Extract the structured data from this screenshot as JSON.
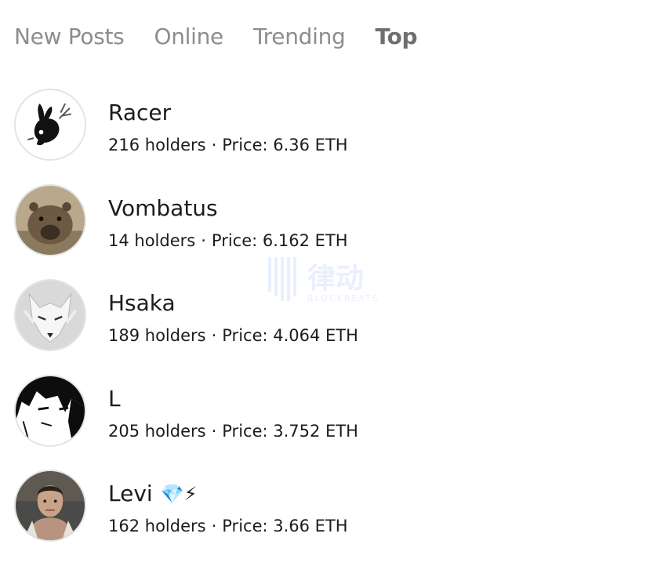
{
  "tabs": [
    {
      "label": "New Posts",
      "active": false
    },
    {
      "label": "Online",
      "active": false
    },
    {
      "label": "Trending",
      "active": false
    },
    {
      "label": "Top",
      "active": true
    }
  ],
  "rows": [
    {
      "name": "Racer",
      "holders": "216 holders",
      "price": "Price: 6.36 ETH",
      "avatar": "rabbit-icon",
      "badges": ""
    },
    {
      "name": "Vombatus",
      "holders": "14 holders",
      "price": "Price: 6.162 ETH",
      "avatar": "wombat-icon",
      "badges": ""
    },
    {
      "name": "Hsaka",
      "holders": "189 holders",
      "price": "Price: 4.064 ETH",
      "avatar": "wolf-icon",
      "badges": ""
    },
    {
      "name": "L",
      "holders": "205 holders",
      "price": "Price: 3.752 ETH",
      "avatar": "anime-face-icon",
      "badges": ""
    },
    {
      "name": "Levi",
      "holders": "162 holders",
      "price": "Price: 3.66 ETH",
      "avatar": "person-photo-icon",
      "badges": "💎⚡"
    }
  ],
  "separator": "·",
  "watermark": {
    "main": "律动",
    "sub": "BLOCKBEATS"
  }
}
